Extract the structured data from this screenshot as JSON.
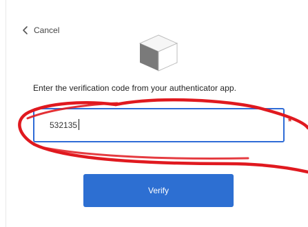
{
  "nav": {
    "cancel_label": "Cancel",
    "cancel_icon": "chevron-left-icon"
  },
  "logo": {
    "icon": "cube-icon"
  },
  "verification": {
    "instruction": "Enter the verification code from your authenticator app.",
    "code_value": "532135",
    "required_marker": "*"
  },
  "actions": {
    "verify_label": "Verify"
  },
  "annotation": {
    "type": "red-freehand-circle",
    "color": "#e0191f"
  },
  "colors": {
    "accent": "#2d6fd2",
    "input_border": "#2e6bd6",
    "required": "#d93025"
  }
}
